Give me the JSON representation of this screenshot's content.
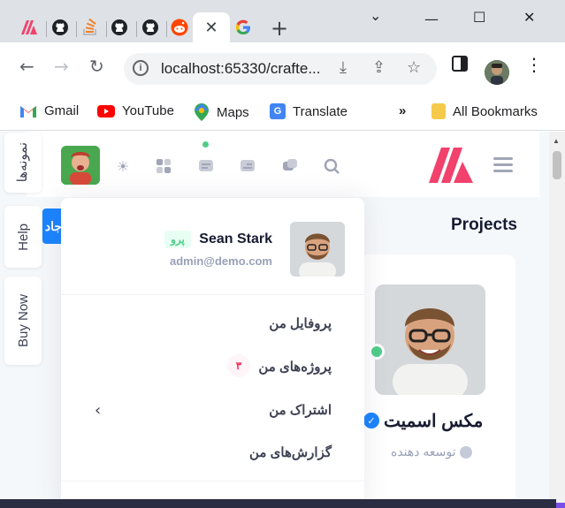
{
  "browser": {
    "tabs": [
      {
        "icon": "metronic-logo-icon"
      },
      {
        "icon": "github-icon"
      },
      {
        "icon": "stackoverflow-icon"
      },
      {
        "icon": "github-icon"
      },
      {
        "icon": "github-icon"
      },
      {
        "icon": "reddit-icon"
      },
      {
        "icon": "close-icon",
        "active": true
      },
      {
        "icon": "google-icon"
      }
    ],
    "new_tab": "+",
    "url": "localhost:65330/crafte...",
    "bookmarks": [
      "Gmail",
      "YouTube",
      "Maps",
      "Translate"
    ],
    "bookmarks_overflow": "»",
    "all_bookmarks": "All Bookmarks"
  },
  "sidebar_tabs": {
    "samples": "نمونه‌ها",
    "help": "Help",
    "buy_now": "Buy Now"
  },
  "header": {
    "icons": [
      "theme-sun-icon",
      "apps-grid-icon",
      "notifications-icon",
      "chat-icon",
      "messages-icon",
      "search-icon",
      "menu-icon"
    ]
  },
  "page": {
    "projects_title": "Projects",
    "blue_tab_text": "جاد",
    "card": {
      "name": "مکس اسمیت",
      "role": "توسعه دهنده"
    }
  },
  "user_menu": {
    "name": "Sean Stark",
    "badge": "پرو",
    "email": "admin@demo.com",
    "items": [
      {
        "label": "پروفایل من"
      },
      {
        "label": "پروژه‌های من",
        "count": "۳"
      },
      {
        "label": "اشتراک من"
      },
      {
        "label": "گزارش‌های من"
      }
    ]
  },
  "colors": {
    "accent": "#1b84ff",
    "success": "#50cd89",
    "danger": "#f8285a",
    "logo": "#f1416c"
  }
}
